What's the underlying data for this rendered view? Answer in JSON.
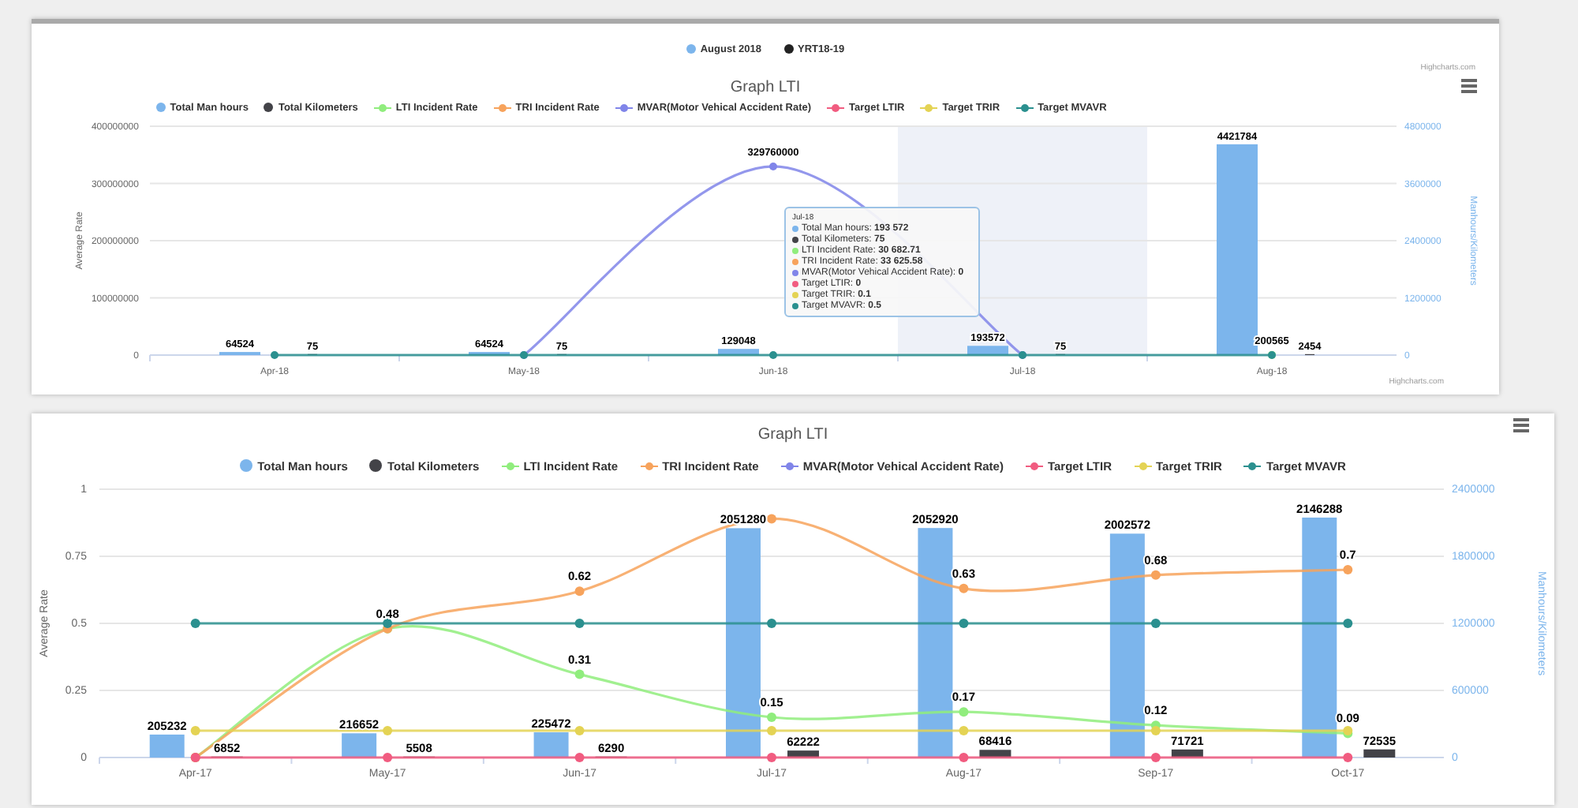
{
  "charts": [
    {
      "top_legend": [
        {
          "label": "August 2018",
          "color": "#7cb5ec"
        },
        {
          "label": "YRT18-19",
          "color": "#222222"
        }
      ],
      "credits": [
        "Highcharts.com",
        "Highcharts.com"
      ],
      "chart_data": {
        "type": "bar",
        "title": "Graph LTI",
        "ylabel": "Average Rate",
        "y2label": "Manhours/Kilometers",
        "categories": [
          "Apr-18",
          "May-18",
          "Jun-18",
          "Jul-18",
          "Aug-18"
        ],
        "ylim": [
          0,
          400000000
        ],
        "yticks": [
          0,
          100000000,
          200000000,
          300000000,
          400000000
        ],
        "y2lim": [
          0,
          4800000
        ],
        "y2ticks": [
          0,
          1200000,
          2400000,
          3600000,
          4800000
        ],
        "stacked": false,
        "grid": true,
        "bands": [
          {
            "axis": "x",
            "from": "Jul-18",
            "to": "Jul-18",
            "color": "#eef1f8"
          }
        ],
        "series": [
          {
            "name": "Total Man hours",
            "type": "bar",
            "axis": "y2",
            "color": "#7cb5ec",
            "values": [
              64524,
              64524,
              129048,
              193572,
              4421784
            ],
            "value_labels": [
              "64524",
              "64524",
              "129048",
              "193572",
              "4421784"
            ]
          },
          {
            "name": "Total Kilometers",
            "type": "bar",
            "axis": "y2",
            "color": "#434348",
            "values": [
              75,
              75,
              null,
              75,
              2454
            ],
            "value_labels": [
              "75",
              "75",
              null,
              "75",
              "2454"
            ]
          },
          {
            "name": "LTI Incident Rate",
            "type": "line",
            "marker": true,
            "color": "#90ed7d",
            "values": [
              null,
              null,
              null,
              null,
              200565
            ],
            "value_labels": [
              null,
              null,
              null,
              null,
              "200565"
            ]
          },
          {
            "name": "TRI Incident Rate",
            "type": "line",
            "color": "#f7a35c",
            "values": [
              null,
              null,
              null,
              null,
              null
            ]
          },
          {
            "name": "MVAR(Motor Vehical Accident Rate)",
            "type": "line",
            "marker": true,
            "color": "#8085e9",
            "values": [
              null,
              0,
              329760000,
              0,
              null
            ],
            "value_labels": [
              null,
              null,
              "329760000",
              null,
              null
            ]
          },
          {
            "name": "Target LTIR",
            "type": "line",
            "color": "#f15c80",
            "values": [
              null,
              null,
              null,
              null,
              null
            ]
          },
          {
            "name": "Target TRIR",
            "type": "line",
            "color": "#e4d354",
            "values": [
              null,
              null,
              null,
              null,
              null
            ]
          },
          {
            "name": "Target MVAVR",
            "type": "line",
            "marker": true,
            "color": "#2b908f",
            "values": [
              0.5,
              0.5,
              0.5,
              0.5,
              0.5
            ]
          }
        ]
      },
      "tooltip": {
        "header": "Jul-18",
        "rows": [
          {
            "text": "Total Man hours: **193 572**",
            "color": "#7cb5ec"
          },
          {
            "text": "Total Kilometers: **75**",
            "color": "#434348"
          },
          {
            "text": "LTI Incident Rate: **30 682.71**",
            "color": "#90ed7d"
          },
          {
            "text": "TRI Incident Rate: **33 625.58**",
            "color": "#f7a35c"
          },
          {
            "text": "MVAR(Motor Vehical Accident Rate): **0**",
            "color": "#8085e9"
          },
          {
            "text": "Target LTIR: **0**",
            "color": "#f15c80"
          },
          {
            "text": "Target TRIR: **0.1**",
            "color": "#e4d354"
          },
          {
            "text": "Target MVAVR: **0.5**",
            "color": "#2b908f"
          }
        ]
      }
    },
    {
      "chart_data": {
        "type": "bar",
        "title": "Graph LTI",
        "ylabel": "Average Rate",
        "y2label": "Manhours/Kilometers",
        "categories": [
          "Apr-17",
          "May-17",
          "Jun-17",
          "Jul-17",
          "Aug-17",
          "Sep-17",
          "Oct-17"
        ],
        "ylim": [
          0,
          1
        ],
        "yticks": [
          0,
          0.25,
          0.5,
          0.75,
          1
        ],
        "y2lim": [
          0,
          2400000
        ],
        "y2ticks": [
          0,
          600000,
          1200000,
          1800000,
          2400000
        ],
        "stacked": false,
        "grid": true,
        "series": [
          {
            "name": "Total Man hours",
            "type": "bar",
            "axis": "y2",
            "color": "#7cb5ec",
            "values": [
              205232,
              216652,
              225472,
              2051280,
              2052920,
              2002572,
              2146288
            ],
            "value_labels": [
              "205232",
              "216652",
              "225472",
              "2051280",
              "2052920",
              "2002572",
              "2146288"
            ]
          },
          {
            "name": "Total Kilometers",
            "type": "bar",
            "axis": "y2",
            "color": "#434348",
            "values": [
              6852,
              5508,
              6290,
              62222,
              68416,
              71721,
              72535
            ],
            "value_labels": [
              "6852",
              "5508",
              "6290",
              "62222",
              "68416",
              "71721",
              "72535"
            ]
          },
          {
            "name": "LTI Incident Rate",
            "type": "line",
            "marker": true,
            "color": "#90ed7d",
            "values": [
              0,
              0.48,
              0.31,
              0.15,
              0.17,
              0.12,
              0.09
            ],
            "value_labels": [
              null,
              "0.48",
              "0.31",
              "0.15",
              "0.17",
              "0.12",
              "0.09"
            ]
          },
          {
            "name": "TRI Incident Rate",
            "type": "line",
            "marker": true,
            "color": "#f7a35c",
            "values": [
              0,
              0.48,
              0.62,
              0.89,
              0.63,
              0.68,
              0.7
            ],
            "value_labels": [
              null,
              null,
              "0.62",
              null,
              "0.63",
              "0.68",
              "0.7"
            ]
          },
          {
            "name": "MVAR(Motor Vehical Accident Rate)",
            "type": "line",
            "color": "#8085e9",
            "values": [
              null,
              null,
              null,
              null,
              null,
              null,
              null
            ]
          },
          {
            "name": "Target LTIR",
            "type": "line",
            "marker": true,
            "color": "#f15c80",
            "values": [
              0,
              0,
              0,
              0,
              0,
              0,
              0
            ]
          },
          {
            "name": "Target TRIR",
            "type": "line",
            "marker": true,
            "color": "#e4d354",
            "values": [
              0.1,
              0.1,
              0.1,
              0.1,
              0.1,
              0.1,
              0.1
            ]
          },
          {
            "name": "Target MVAVR",
            "type": "line",
            "marker": true,
            "color": "#2b908f",
            "values": [
              0.5,
              0.5,
              0.5,
              0.5,
              0.5,
              0.5,
              0.5
            ]
          }
        ]
      }
    }
  ]
}
